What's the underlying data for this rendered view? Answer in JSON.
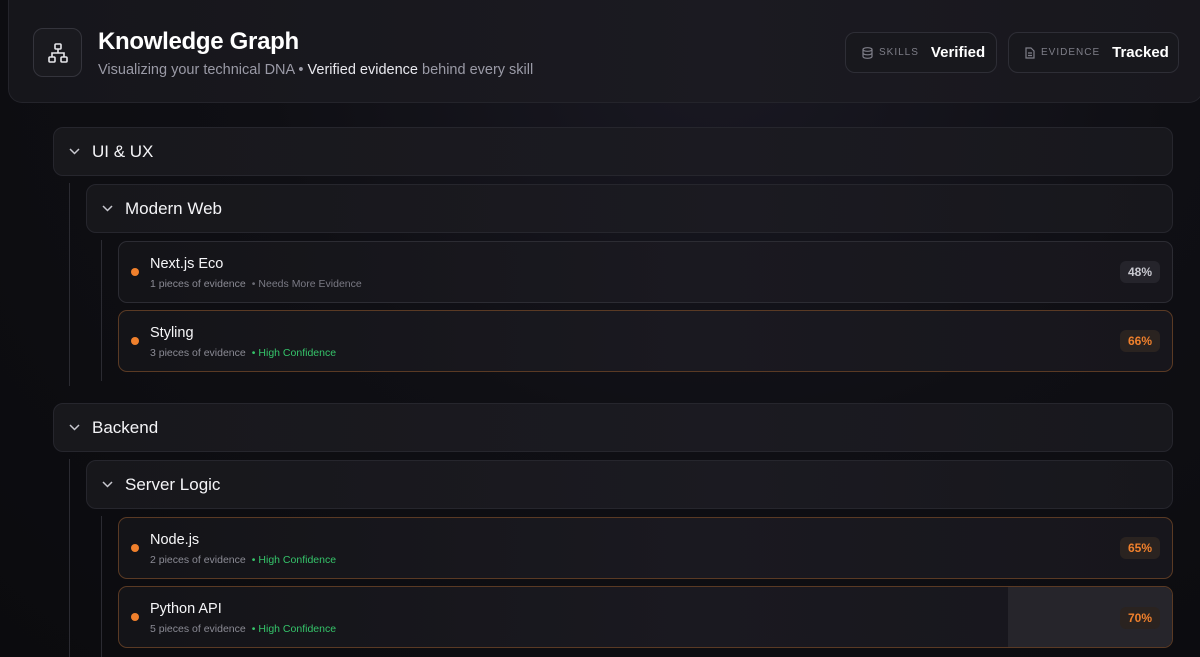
{
  "header": {
    "title": "Knowledge Graph",
    "subtitle_prefix": "Visualizing your technical DNA •",
    "subtitle_highlight": "Verified evidence",
    "subtitle_suffix": "behind every skill",
    "stats": [
      {
        "icon": "database-icon",
        "label": "SKILLS",
        "value": "Verified"
      },
      {
        "icon": "document-icon",
        "label": "EVIDENCE",
        "value": "Tracked"
      }
    ]
  },
  "groups": [
    {
      "name": "UI & UX",
      "subgroups": [
        {
          "name": "Modern Web",
          "skills": [
            {
              "name": "Next.js Eco",
              "evidence": "1 pieces of evidence",
              "confidence": "Needs More Evidence",
              "percent": "48%",
              "level": 48
            },
            {
              "name": "Styling",
              "evidence": "3 pieces of evidence",
              "confidence": "High Confidence",
              "percent": "66%",
              "level": 66
            }
          ]
        }
      ]
    },
    {
      "name": "Backend",
      "subgroups": [
        {
          "name": "Server Logic",
          "skills": [
            {
              "name": "Node.js",
              "evidence": "2 pieces of evidence",
              "confidence": "High Confidence",
              "percent": "65%",
              "level": 65
            },
            {
              "name": "Python API",
              "evidence": "5 pieces of evidence",
              "confidence": "High Confidence",
              "percent": "70%",
              "level": 70
            }
          ]
        }
      ]
    }
  ],
  "colors": {
    "accent": "#f0802c",
    "high_confidence": "#35c46a",
    "muted": "#8b8b95"
  }
}
